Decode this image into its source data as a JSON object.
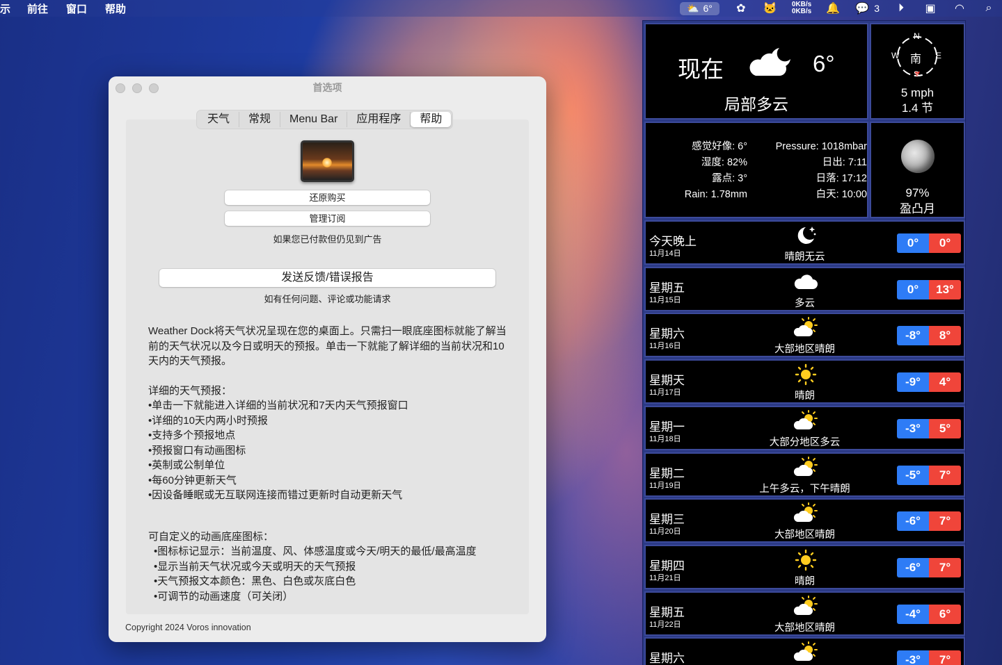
{
  "menubar": {
    "items": [
      "前往",
      "窗口",
      "帮助"
    ],
    "leading_fragment": "示",
    "weather_temp": "6°",
    "net_up": "0KB/s",
    "net_down": "0KB/s",
    "wechat_count": "3"
  },
  "window": {
    "title": "首选项",
    "tabs": [
      {
        "label": "天气"
      },
      {
        "label": "常规"
      },
      {
        "label": "Menu Bar"
      },
      {
        "label": "应用程序"
      },
      {
        "label": "帮助",
        "active": true
      }
    ],
    "restore_label": "还原购买",
    "manage_label": "管理订阅",
    "ads_note": "如果您已付款但仍见到广告",
    "feedback_label": "发送反馈/错误报告",
    "feedback_note": "如有任何问题、评论或功能请求",
    "intro": "Weather Dock将天气状况呈现在您的桌面上。只需扫一眼底座图标就能了解当前的天气状况以及今日或明天的预报。单击一下就能了解详细的当前状况和10天内的天气预报。",
    "detail_heading": "详细的天气预报：",
    "detail_items": [
      "•单击一下就能进入详细的当前状况和7天内天气预报窗口",
      "•详细的10天内两小时预报",
      "•支持多个预报地点",
      "•预报窗口有动画图标",
      "•英制或公制单位",
      "•每60分钟更新天气",
      "•因设备睡眠或无互联网连接而错过更新时自动更新天气"
    ],
    "custom_heading": "可自定义的动画底座图标：",
    "custom_items": [
      "•图标标记显示：当前温度、风、体感温度或今天/明天的最低/最高温度",
      "•显示当前天气状况或今天或明天的天气预报",
      "•天气预报文本颜色：黑色、白色或灰底白色",
      "•可调节的动画速度（可关闭）"
    ],
    "copyright": "Copyright 2024 Voros innovation"
  },
  "weather": {
    "now_label": "现在",
    "now_temp": "6°",
    "now_condition": "局部多云",
    "compass": {
      "n": "N",
      "w": "W",
      "e": "E",
      "s": "S",
      "dir": "南"
    },
    "wind_mph": "5 mph",
    "wind_knots": "1.4 节",
    "details_left": [
      "感觉好像: 6°",
      "湿度: 82%",
      "露点: 3°",
      "Rain: 1.78mm"
    ],
    "details_right": [
      "Pressure: 1018mbar",
      "日出: 7:11",
      "日落: 17:12",
      "白天: 10:00"
    ],
    "moon_percent": "97%",
    "moon_phase": "盈凸月",
    "forecast": [
      {
        "name": "今天晚上",
        "date": "11月14日",
        "icon": "moon-stars-icon",
        "cond": "晴朗无云",
        "lo": "0°",
        "hi": "0°"
      },
      {
        "name": "星期五",
        "date": "11月15日",
        "icon": "cloud-icon",
        "cond": "多云",
        "lo": "0°",
        "hi": "13°"
      },
      {
        "name": "星期六",
        "date": "11月16日",
        "icon": "sun-cloud-icon",
        "cond": "大部地区晴朗",
        "lo": "-8°",
        "hi": "8°"
      },
      {
        "name": "星期天",
        "date": "11月17日",
        "icon": "sun-icon",
        "cond": "晴朗",
        "lo": "-9°",
        "hi": "4°"
      },
      {
        "name": "星期一",
        "date": "11月18日",
        "icon": "sun-cloud-icon",
        "cond": "大部分地区多云",
        "lo": "-3°",
        "hi": "5°"
      },
      {
        "name": "星期二",
        "date": "11月19日",
        "icon": "sun-cloud-icon",
        "cond": "上午多云，下午晴朗",
        "lo": "-5°",
        "hi": "7°"
      },
      {
        "name": "星期三",
        "date": "11月20日",
        "icon": "sun-cloud-icon",
        "cond": "大部地区晴朗",
        "lo": "-6°",
        "hi": "7°"
      },
      {
        "name": "星期四",
        "date": "11月21日",
        "icon": "sun-icon",
        "cond": "晴朗",
        "lo": "-6°",
        "hi": "7°"
      },
      {
        "name": "星期五",
        "date": "11月22日",
        "icon": "sun-cloud-icon",
        "cond": "大部地区晴朗",
        "lo": "-4°",
        "hi": "6°"
      },
      {
        "name": "星期六",
        "date": "",
        "icon": "sun-cloud-icon",
        "cond": "",
        "lo": "-3°",
        "hi": "7°"
      }
    ]
  },
  "colors": {
    "low_temp_bg": "#2e7cf6",
    "high_temp_bg": "#f0453a",
    "sun": "#ffcc1f"
  }
}
